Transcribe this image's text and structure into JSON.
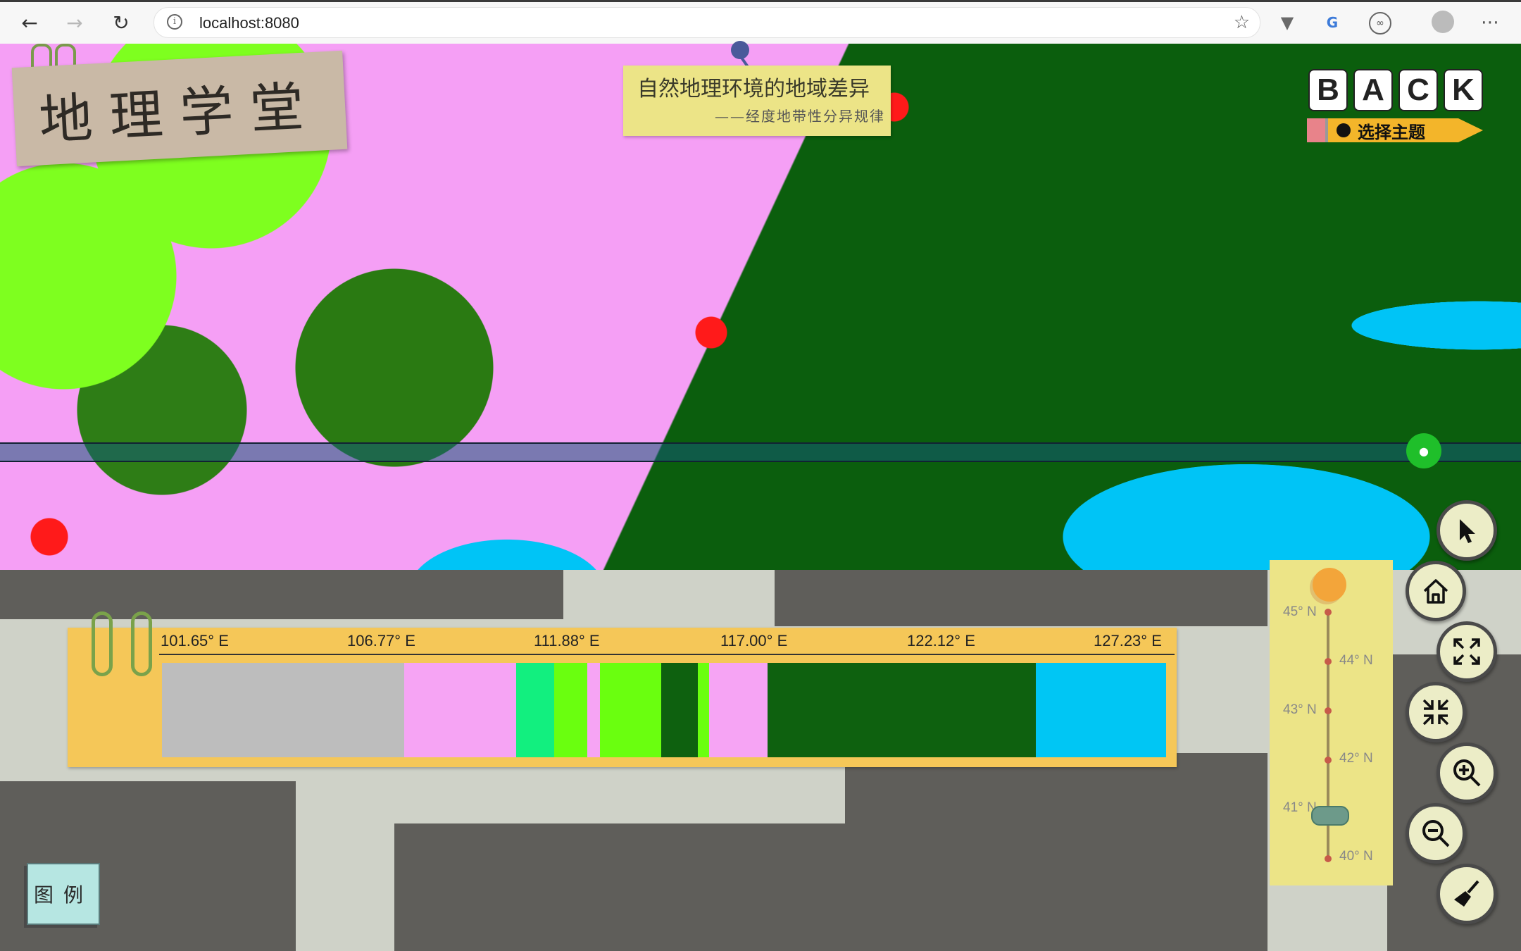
{
  "browser": {
    "url": "localhost:8080",
    "info_icon": "i"
  },
  "app": {
    "title": "地理学堂",
    "topic_title": "自然地理环境的地域差异",
    "topic_subtitle": "——经度地带性分异规律",
    "back_letters": [
      "B",
      "A",
      "C",
      "K"
    ],
    "select_topic_label": "选择主题"
  },
  "profile": {
    "longitudes": [
      "101.65° E",
      "106.77° E",
      "111.88° E",
      "117.00° E",
      "122.12° E",
      "127.23° E"
    ],
    "segments": [
      {
        "color": "#bdbdbd",
        "fraction": 0.2415
      },
      {
        "color": "#f6a4f4",
        "fraction": 0.1109
      },
      {
        "color": "#12ef7f",
        "fraction": 0.0379
      },
      {
        "color": "#6aff0f",
        "fraction": 0.033
      },
      {
        "color": "#f6a4f4",
        "fraction": 0.0126
      },
      {
        "color": "#6aff0f",
        "fraction": 0.061
      },
      {
        "color": "#0e610f",
        "fraction": 0.0365
      },
      {
        "color": "#6aff0f",
        "fraction": 0.0112
      },
      {
        "color": "#f6a4f4",
        "fraction": 0.0582
      },
      {
        "color": "#0e610f",
        "fraction": 0.2672
      },
      {
        "color": "#00c6f4",
        "fraction": 0.13
      }
    ]
  },
  "latitude": {
    "labels": [
      "45° N",
      "44° N",
      "43° N",
      "42° N",
      "41° N",
      "40° N"
    ],
    "selected": "41° N"
  },
  "tools": [
    {
      "name": "pointer",
      "icon": "cursor-icon"
    },
    {
      "name": "home",
      "icon": "home-icon"
    },
    {
      "name": "expand",
      "icon": "expand-icon"
    },
    {
      "name": "collapse",
      "icon": "collapse-icon"
    },
    {
      "name": "zoom-in",
      "icon": "zoom-in-icon"
    },
    {
      "name": "zoom-out",
      "icon": "zoom-out-icon"
    },
    {
      "name": "clear",
      "icon": "broom-icon"
    }
  ],
  "legend_label": "图例"
}
